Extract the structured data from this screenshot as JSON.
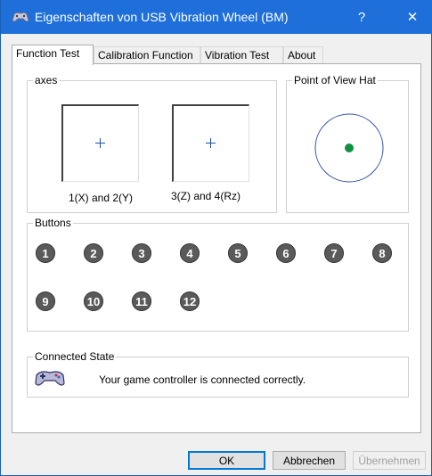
{
  "window": {
    "title": "Eigenschaften von USB Vibration Wheel (BM)",
    "help_label": "?",
    "close_label": "✕"
  },
  "tabs": [
    {
      "label": "Function Test",
      "active": true
    },
    {
      "label": "Calibration Function",
      "active": false
    },
    {
      "label": "Vibration Test",
      "active": false
    },
    {
      "label": "About",
      "active": false
    }
  ],
  "axes": {
    "group_label": "axes",
    "axis1_caption": "1(X) and 2(Y)",
    "axis2_caption": "3(Z) and 4(Rz)"
  },
  "pov": {
    "group_label": "Point of View Hat",
    "indicator_color": "#109040"
  },
  "buttons": {
    "group_label": "Buttons",
    "items": [
      "1",
      "2",
      "3",
      "4",
      "5",
      "6",
      "7",
      "8",
      "9",
      "10",
      "11",
      "12"
    ]
  },
  "connected": {
    "group_label": "Connected State",
    "message": "Your game controller is connected correctly."
  },
  "footer": {
    "ok_label": "OK",
    "cancel_label": "Abbrechen",
    "apply_label": "Übernehmen"
  },
  "colors": {
    "titlebar": "#1e6fd9",
    "accent": "#0078d7"
  }
}
